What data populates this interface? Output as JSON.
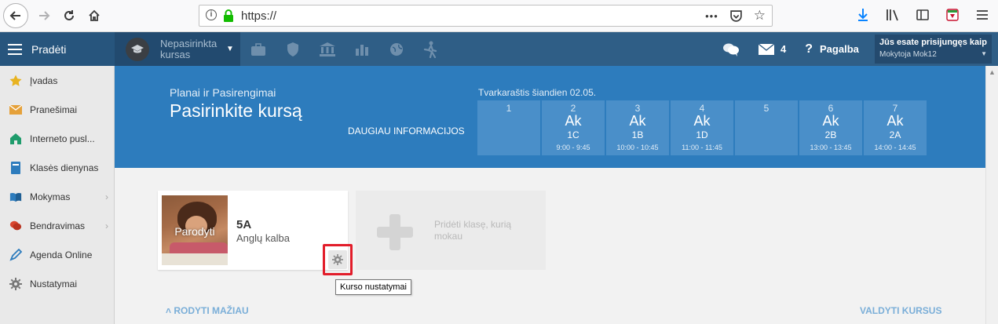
{
  "browser": {
    "url": "https://",
    "dots": "•••"
  },
  "header": {
    "start_label": "Pradėti",
    "course_select": "Nepasirinkta kursas",
    "messages_count": "4",
    "help_label": "Pagalba",
    "login_title": "Jūs esate prisijungęs kaip",
    "login_user": "Mokytoja Mok12"
  },
  "sidebar": {
    "items": [
      {
        "label": "Įvadas",
        "icon": "star-icon"
      },
      {
        "label": "Pranešimai",
        "icon": "envelope-icon"
      },
      {
        "label": "Interneto pusl...",
        "icon": "house-icon"
      },
      {
        "label": "Klasės dienynas",
        "icon": "book-icon"
      },
      {
        "label": "Mokymas",
        "icon": "open-book-icon"
      },
      {
        "label": "Bendravimas",
        "icon": "chat-icon"
      },
      {
        "label": "Agenda Online",
        "icon": "pen-icon"
      },
      {
        "label": "Nustatymai",
        "icon": "gear-icon"
      }
    ]
  },
  "banner": {
    "subtitle": "Planai ir Pasirengimai",
    "title": "Pasirinkite kursą",
    "more_info": "DAUGIAU INFORMACIJOS",
    "timetable_title": "Tvarkaraštis šiandien 02.05.",
    "lessons": [
      {
        "num": "1",
        "subject": "",
        "class": "",
        "time": ""
      },
      {
        "num": "2",
        "subject": "Ak",
        "class": "1C",
        "time": "9:00 - 9:45"
      },
      {
        "num": "3",
        "subject": "Ak",
        "class": "1B",
        "time": "10:00 - 10:45"
      },
      {
        "num": "4",
        "subject": "Ak",
        "class": "1D",
        "time": "11:00 - 11:45"
      },
      {
        "num": "5",
        "subject": "",
        "class": "",
        "time": ""
      },
      {
        "num": "6",
        "subject": "Ak",
        "class": "2B",
        "time": "13:00 - 13:45"
      },
      {
        "num": "7",
        "subject": "Ak",
        "class": "2A",
        "time": "14:00 - 14:45"
      }
    ]
  },
  "course_card": {
    "show_label": "Parodyti",
    "class_name": "5A",
    "subject": "Anglų kalba"
  },
  "add_card": {
    "label": "Pridėti klasę, kurią mokau"
  },
  "tooltip": "Kurso nustatymai",
  "footer": {
    "show_less": "RODYTI MAŽIAU",
    "manage_courses": "VALDYTI KURSUS"
  },
  "colors": {
    "header": "#2f5e86",
    "banner": "#2d7cbd",
    "highlight": "#e21d2a"
  }
}
